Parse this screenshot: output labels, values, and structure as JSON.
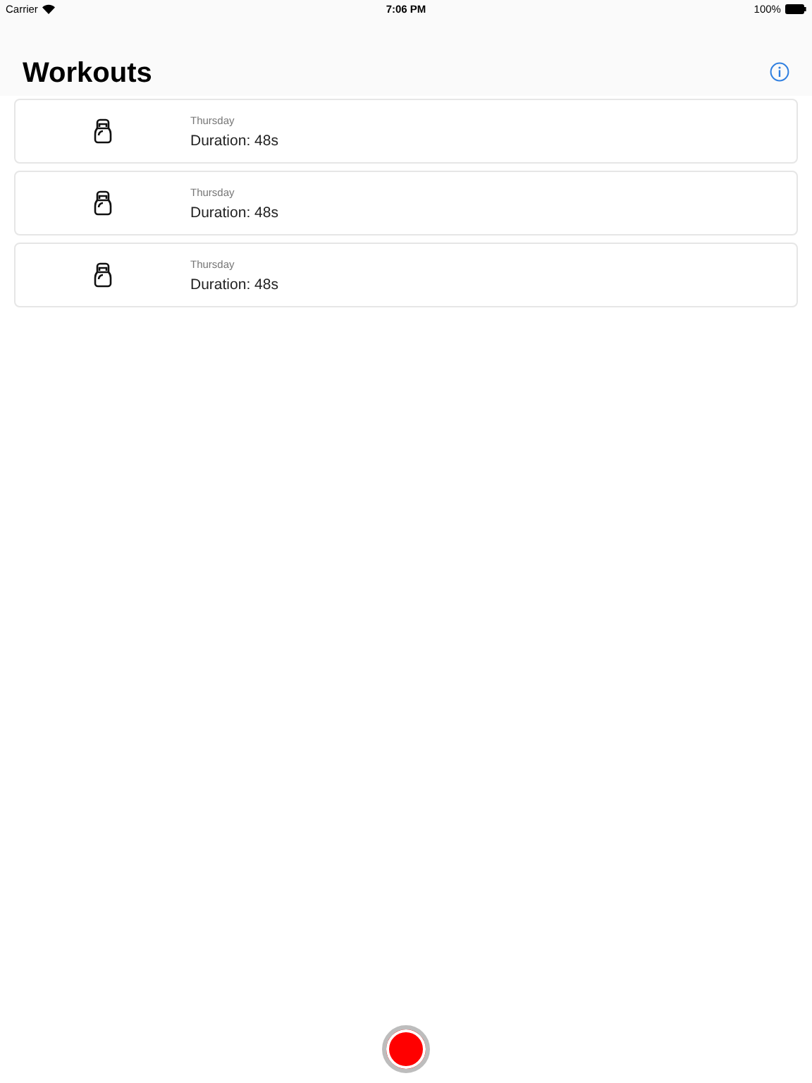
{
  "status_bar": {
    "carrier": "Carrier",
    "time": "7:06 PM",
    "battery": "100%"
  },
  "title": "Workouts",
  "workouts": [
    {
      "day": "Thursday",
      "duration": "Duration: 48s"
    },
    {
      "day": "Thursday",
      "duration": "Duration: 48s"
    },
    {
      "day": "Thursday",
      "duration": "Duration: 48s"
    }
  ]
}
